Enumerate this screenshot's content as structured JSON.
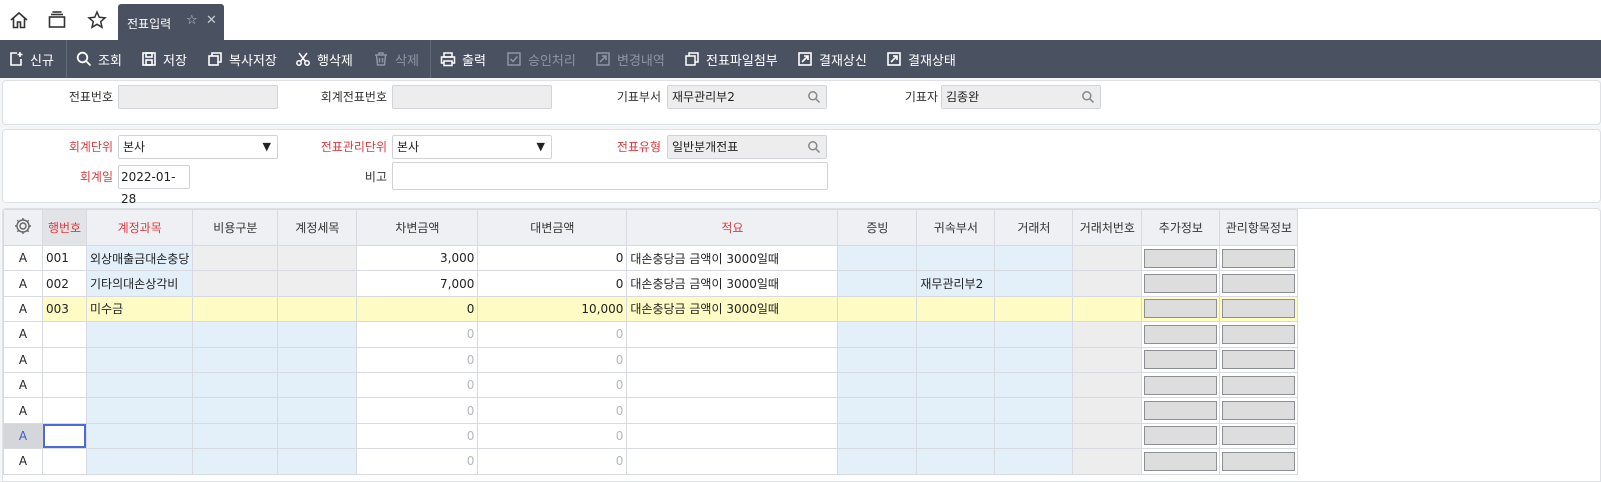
{
  "tabstrip": {
    "active_tab_label": "전표입력",
    "icons": [
      "home-icon",
      "layers-icon",
      "star-icon"
    ]
  },
  "toolbar": {
    "new": "신규",
    "search": "조회",
    "save": "저장",
    "copy_save": "복사저장",
    "row_delete": "행삭제",
    "delete": "삭제",
    "print": "출력",
    "approve": "승인처리",
    "history": "변경내역",
    "attach": "전표파일첨부",
    "submit_approval": "결재상신",
    "approval_status": "결재상태"
  },
  "header_form": {
    "voucher_no_label": "전표번호",
    "voucher_no_value": "",
    "acct_voucher_no_label": "회계전표번호",
    "acct_voucher_no_value": "",
    "dept_label": "기표부서",
    "dept_value": "재무관리부2",
    "writer_label": "기표자",
    "writer_value": "김종완"
  },
  "detail_form": {
    "acct_unit_label": "회계단위",
    "acct_unit_value": "본사",
    "mgmt_unit_label": "전표관리단위",
    "mgmt_unit_value": "본사",
    "voucher_type_label": "전표유형",
    "voucher_type_value": "일반분개전표",
    "acct_date_label": "회계일",
    "acct_date_value": "2022-01-28",
    "memo_label": "비고",
    "memo_value": ""
  },
  "grid": {
    "columns": [
      "행번호",
      "계정과목",
      "비용구분",
      "계정세목",
      "차변금액",
      "대변금액",
      "적요",
      "증빙",
      "귀속부서",
      "거래처",
      "거래처번호",
      "추가정보",
      "관리항목정보"
    ],
    "rows": [
      {
        "state": "A",
        "no": "001",
        "account": "외상매출금대손충당",
        "cost": "",
        "sub": "",
        "debit": "3,000",
        "credit": "0",
        "summary": "대손충당금 금액이 3000일때",
        "evidence": "",
        "dept": "",
        "vendor": "",
        "vendor_no": ""
      },
      {
        "state": "A",
        "no": "002",
        "account": "기타의대손상각비",
        "cost": "",
        "sub": "",
        "debit": "7,000",
        "credit": "0",
        "summary": "대손충당금 금액이 3000일때",
        "evidence": "",
        "dept": "재무관리부2",
        "vendor": "",
        "vendor_no": ""
      },
      {
        "state": "A",
        "no": "003",
        "account": "미수금",
        "cost": "",
        "sub": "",
        "debit": "0",
        "credit": "10,000",
        "summary": "대손충당금 금액이 3000일때",
        "evidence": "",
        "dept": "",
        "vendor": "",
        "vendor_no": ""
      },
      {
        "state": "A",
        "no": "",
        "account": "",
        "cost": "",
        "sub": "",
        "debit": "0",
        "credit": "0",
        "summary": "",
        "evidence": "",
        "dept": "",
        "vendor": "",
        "vendor_no": ""
      },
      {
        "state": "A",
        "no": "",
        "account": "",
        "cost": "",
        "sub": "",
        "debit": "0",
        "credit": "0",
        "summary": "",
        "evidence": "",
        "dept": "",
        "vendor": "",
        "vendor_no": ""
      },
      {
        "state": "A",
        "no": "",
        "account": "",
        "cost": "",
        "sub": "",
        "debit": "0",
        "credit": "0",
        "summary": "",
        "evidence": "",
        "dept": "",
        "vendor": "",
        "vendor_no": ""
      },
      {
        "state": "A",
        "no": "",
        "account": "",
        "cost": "",
        "sub": "",
        "debit": "0",
        "credit": "0",
        "summary": "",
        "evidence": "",
        "dept": "",
        "vendor": "",
        "vendor_no": ""
      },
      {
        "state": "A",
        "no": "",
        "account": "",
        "cost": "",
        "sub": "",
        "debit": "0",
        "credit": "0",
        "summary": "",
        "evidence": "",
        "dept": "",
        "vendor": "",
        "vendor_no": ""
      },
      {
        "state": "A",
        "no": "",
        "account": "",
        "cost": "",
        "sub": "",
        "debit": "0",
        "credit": "0",
        "summary": "",
        "evidence": "",
        "dept": "",
        "vendor": "",
        "vendor_no": ""
      }
    ],
    "highlight_row": 2,
    "active_row": 7
  },
  "colors": {
    "toolbar": "#4a5160",
    "required": "#e0393e",
    "row_highlight": "#fffbc4",
    "editable_cell": "#e3eff9"
  }
}
